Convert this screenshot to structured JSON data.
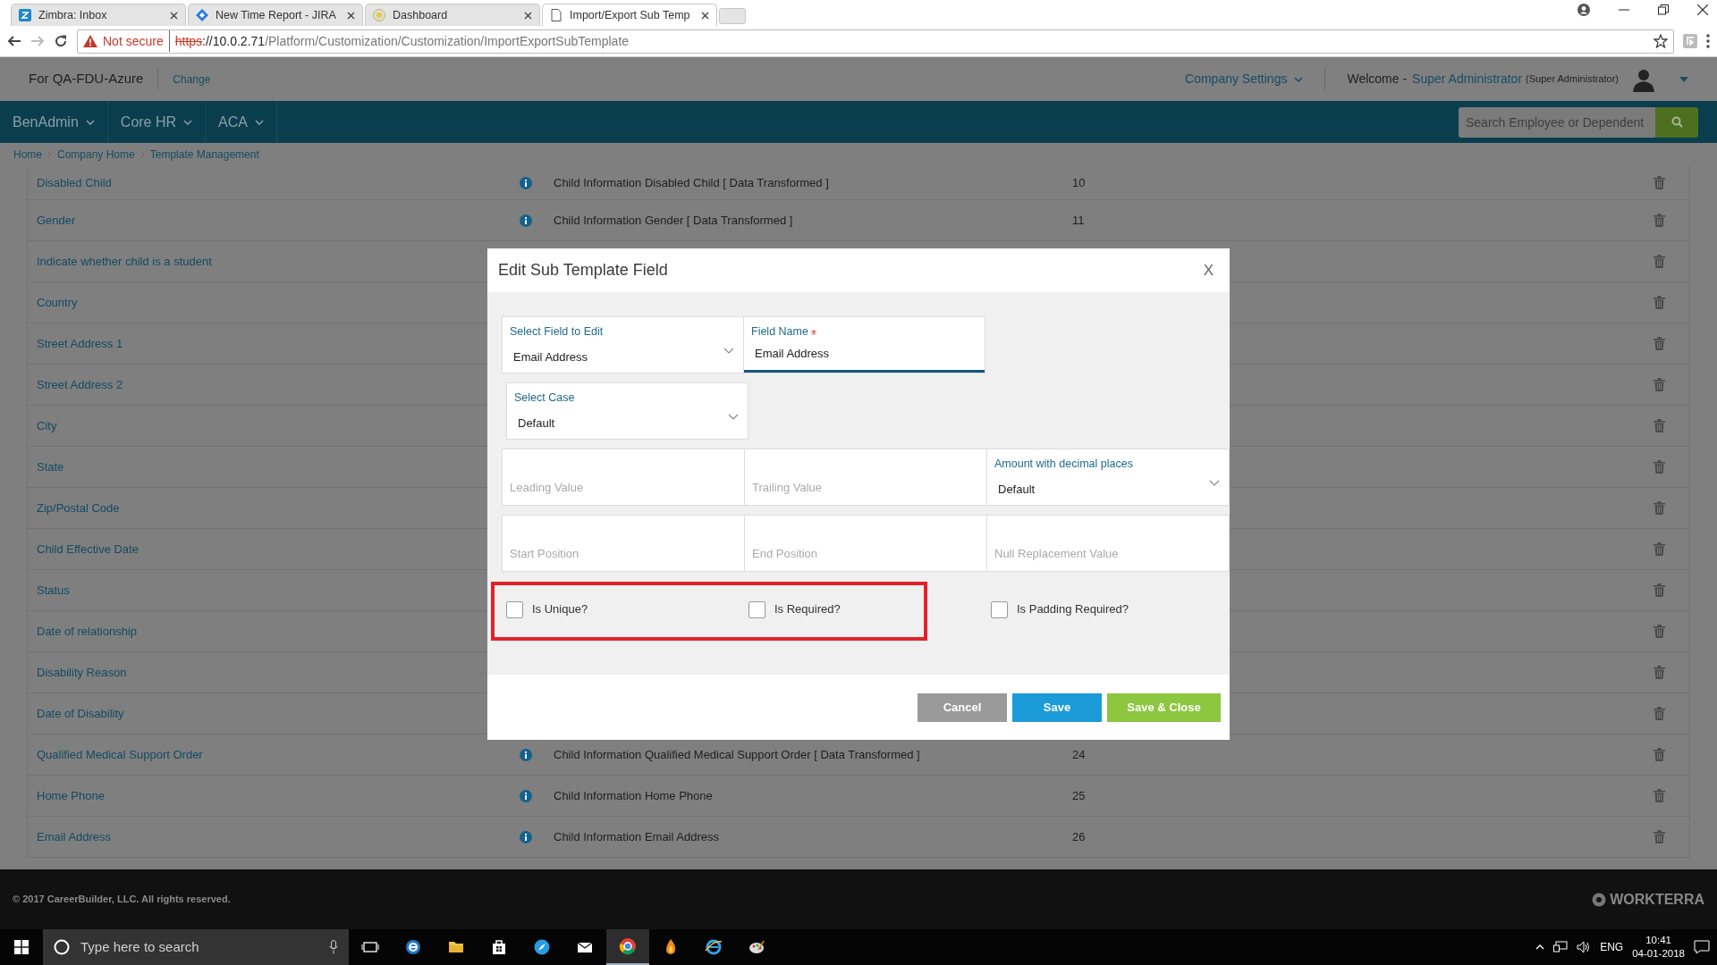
{
  "browser": {
    "tabs": [
      {
        "title": "Zimbra: Inbox",
        "selected": false
      },
      {
        "title": "New Time Report - JIRA",
        "selected": false
      },
      {
        "title": "Dashboard",
        "selected": false
      },
      {
        "title": "Import/Export Sub Temp",
        "selected": true
      }
    ],
    "security": "Not secure",
    "url_scheme": "https",
    "url_host": "://10.0.2.71",
    "url_path": "/Platform/Customization/Customization/ImportExportSubTemplate"
  },
  "header": {
    "company": "For QA-FDU-Azure",
    "change_link": "Change",
    "settings": "Company Settings",
    "welcome": "Welcome -",
    "user": "Super Administrator",
    "role": "(Super Administrator)"
  },
  "nav": {
    "menus": [
      "BenAdmin",
      "Core HR",
      "ACA"
    ],
    "search": {
      "placeholder": "Search Employee or Dependent"
    }
  },
  "breadcrumb": [
    "Home",
    "Company Home",
    "Template Management"
  ],
  "rows": [
    {
      "name": "Disabled Child",
      "description": "Child Information Disabled Child [ Data Transformed ]",
      "order": "10"
    },
    {
      "name": "Gender",
      "description": "Child Information Gender [ Data Transformed ]",
      "order": "11"
    },
    {
      "name": "Indicate whether child is a student"
    },
    {
      "name": "Country"
    },
    {
      "name": "Street Address 1"
    },
    {
      "name": "Street Address 2"
    },
    {
      "name": "City"
    },
    {
      "name": "State"
    },
    {
      "name": "Zip/Postal Code"
    },
    {
      "name": "Child Effective Date"
    },
    {
      "name": "Status"
    },
    {
      "name": "Date of relationship"
    },
    {
      "name": "Disability Reason"
    },
    {
      "name": "Date of Disability"
    },
    {
      "name": "Qualified Medical Support Order",
      "description": "Child Information Qualified Medical Support Order [ Data Transformed ]",
      "order": "24"
    },
    {
      "name": "Home Phone",
      "description": "Child Information Home Phone",
      "order": "25"
    },
    {
      "name": "Email Address",
      "description": "Child Information Email Address",
      "order": "26"
    }
  ],
  "modal": {
    "title": "Edit Sub Template Field",
    "close": "X",
    "field_rows": [
      [
        {
          "kind": "select",
          "label": "Select Field to Edit",
          "value": "Email Address"
        },
        {
          "kind": "text",
          "label": "Field Name",
          "value": "Email Address",
          "required": true,
          "focused": true
        }
      ],
      [
        {
          "kind": "select",
          "label": "Select Case",
          "value": "Default"
        }
      ],
      [
        {
          "kind": "input",
          "placeholder": "Leading Value"
        },
        {
          "kind": "input",
          "placeholder": "Trailing Value"
        },
        {
          "kind": "select",
          "label": "Amount with decimal places",
          "value": "Default"
        }
      ],
      [
        {
          "kind": "input",
          "placeholder": "Start Position"
        },
        {
          "kind": "input",
          "placeholder": "End Position"
        },
        {
          "kind": "input",
          "placeholder": "Null Replacement Value"
        }
      ]
    ],
    "checkboxes": [
      {
        "label": "Is Unique?",
        "checked": false,
        "highlighted": true
      },
      {
        "label": "Is Required?",
        "checked": false,
        "highlighted": true
      },
      {
        "label": "Is Padding Required?",
        "checked": false,
        "highlighted": false
      }
    ],
    "buttons": [
      {
        "label": "Cancel",
        "kind": "cancel"
      },
      {
        "label": "Save",
        "kind": "save"
      },
      {
        "label": "Save & Close",
        "kind": "save-close"
      }
    ]
  },
  "footer": {
    "copyright": "© 2017 CareerBuilder, LLC. All rights reserved.",
    "brand": "WORKTERRA"
  },
  "taskbar": {
    "search_placeholder": "Type here to search",
    "language": "ENG",
    "time": "10:41",
    "date": "04-01-2018"
  }
}
